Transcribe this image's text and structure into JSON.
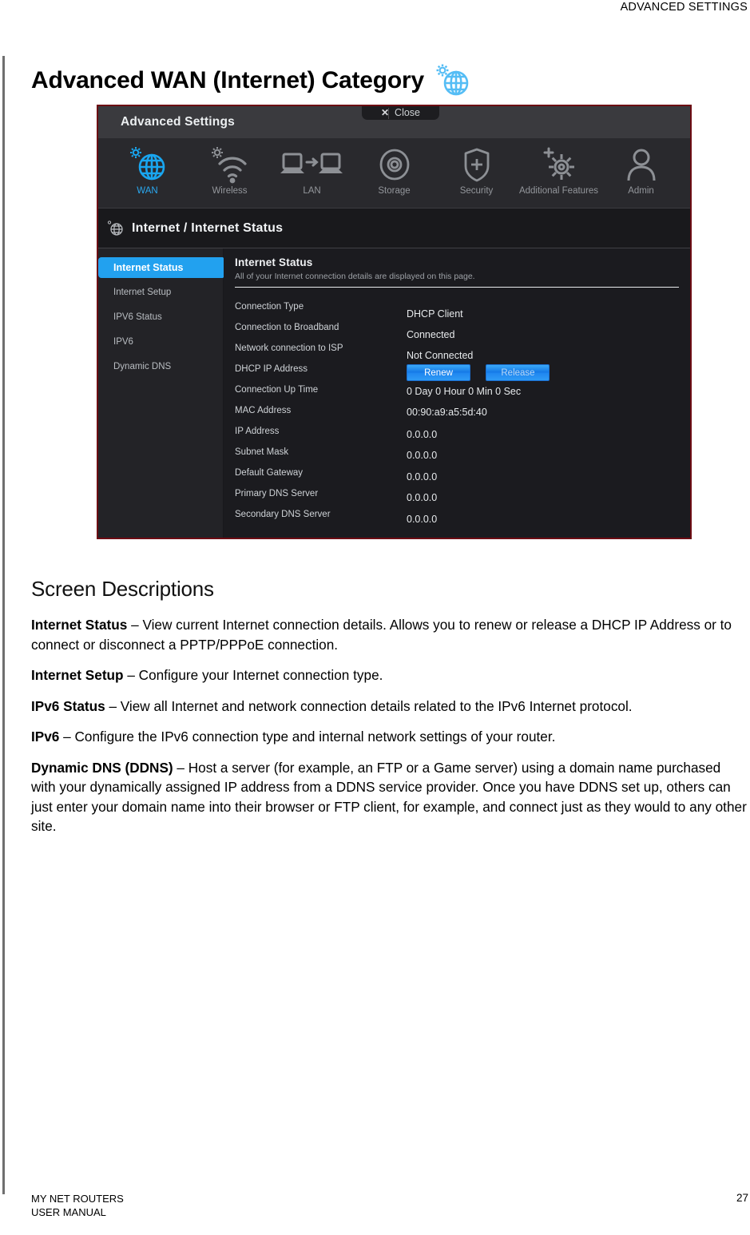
{
  "page_header": {
    "text": "ADVANCED SETTINGS"
  },
  "section": {
    "title": "Advanced WAN (Internet) Category",
    "icon": "wan-globe-gear-icon"
  },
  "screenshot": {
    "window": {
      "title": "Advanced Settings",
      "close_label": "Close",
      "close_icon": "close-x-icon"
    },
    "nav_tabs": [
      {
        "label": "WAN",
        "icon": "globe-gear-icon",
        "active": true
      },
      {
        "label": "Wireless",
        "icon": "wifi-gear-icon",
        "active": false
      },
      {
        "label": "LAN",
        "icon": "two-laptops-arrow-icon",
        "active": false
      },
      {
        "label": "Storage",
        "icon": "disk-icon",
        "active": false
      },
      {
        "label": "Security",
        "icon": "shield-plus-icon",
        "active": false
      },
      {
        "label": "Additional Features",
        "icon": "gear-sparkle-icon",
        "active": false
      },
      {
        "label": "Admin",
        "icon": "person-icon",
        "active": false
      }
    ],
    "breadcrumb": {
      "text": "Internet / Internet Status",
      "icon": "globe-small-icon"
    },
    "sidebar": [
      {
        "label": "Internet Status",
        "active": true
      },
      {
        "label": "Internet Setup",
        "active": false
      },
      {
        "label": "IPV6 Status",
        "active": false
      },
      {
        "label": "IPV6",
        "active": false
      },
      {
        "label": "Dynamic DNS",
        "active": false
      }
    ],
    "panel": {
      "heading": "Internet Status",
      "subheading": "All of your Internet connection details are displayed on this page.",
      "rows": [
        {
          "key": "Connection Type",
          "value": "DHCP Client"
        },
        {
          "key": "Connection to Broadband",
          "value": "Connected"
        },
        {
          "key": "Network connection to ISP",
          "value": "Not Connected"
        },
        {
          "key": "DHCP IP Address",
          "value": "",
          "buttons": [
            "Renew",
            "Release"
          ]
        },
        {
          "key": "Connection Up Time",
          "value": "0 Day 0 Hour 0 Min 0 Sec"
        },
        {
          "key": "MAC Address",
          "value": "00:90:a9:a5:5d:40"
        },
        {
          "key": "IP Address",
          "value": "0.0.0.0"
        },
        {
          "key": "Subnet Mask",
          "value": "0.0.0.0"
        },
        {
          "key": "Default Gateway",
          "value": "0.0.0.0"
        },
        {
          "key": "Primary DNS Server",
          "value": "0.0.0.0"
        },
        {
          "key": "Secondary DNS Server",
          "value": "0.0.0.0"
        }
      ],
      "buttons": {
        "renew": "Renew",
        "release": "Release"
      }
    },
    "colors": {
      "accent_blue": "#22a1ef",
      "border_red": "#6d0c13",
      "panel_bg": "#1b1b1f",
      "topbar_bg": "#3a3a3e"
    }
  },
  "descriptions": {
    "title": "Screen Descriptions",
    "items": [
      {
        "term": "Internet Status",
        "body": " – View current Internet connection details. Allows you to renew or release a DHCP IP Address or to connect or disconnect a PPTP/PPPoE connection."
      },
      {
        "term": "Internet Setup",
        "body": " – Configure your Internet connection type."
      },
      {
        "term": "IPv6 Status",
        "body": " – View all Internet and network connection details related to the IPv6 Internet protocol."
      },
      {
        "term": "IPv6",
        "body": " – Configure the IPv6 connection type and internal network settings of your router."
      },
      {
        "term": "Dynamic DNS (DDNS)",
        "body": " – Host a server (for example, an FTP or a Game server) using a domain name purchased with your dynamically assigned IP address from a DDNS service provider. Once you have DDNS set up, others can just enter your domain name into their browser or FTP client, for example, and connect just as they would to any other site."
      }
    ]
  },
  "footer": {
    "line1": "MY NET ROUTERS",
    "line2": "USER MANUAL",
    "page_number": "27"
  }
}
